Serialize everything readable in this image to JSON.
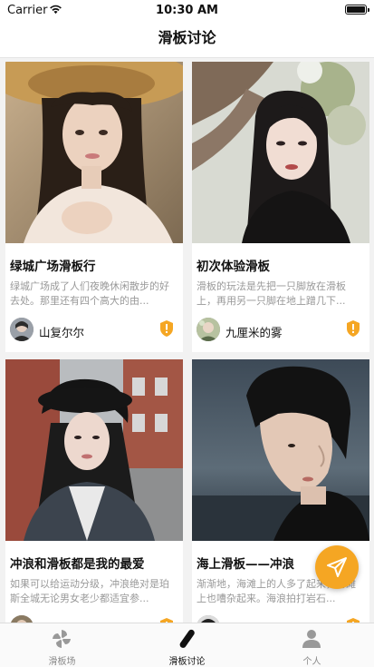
{
  "status_bar": {
    "carrier": "Carrier",
    "time": "10:30 AM"
  },
  "nav": {
    "title": "滑板讨论"
  },
  "posts": [
    {
      "title": "绿城广场滑板行",
      "desc": "绿城广场成了人们夜晚休闲散步的好去处。那里还有四个高大的由...",
      "author": "山复尔尔"
    },
    {
      "title": "初次体验滑板",
      "desc": "滑板的玩法是先把一只脚放在滑板上，再用另一只脚在地上蹭几下...",
      "author": "九厘米的雾"
    },
    {
      "title": "冲浪和滑板都是我的最爱",
      "desc": "如果可以给运动分级，冲浪绝对是珀斯全城无论男女老少都适宜参...",
      "author": ""
    },
    {
      "title": "海上滑板——冲浪",
      "desc": "渐渐地，海滩上的人多了起来，海滩上也嘈杂起来。海浪拍打岩石...",
      "author": ""
    }
  ],
  "tabs": [
    {
      "label": "滑板场",
      "icon": "pinwheel-icon"
    },
    {
      "label": "滑板讨论",
      "icon": "skateboard-icon"
    },
    {
      "label": "个人",
      "icon": "person-icon"
    }
  ],
  "colors": {
    "accent": "#f5a623",
    "shield": "#f5a623"
  }
}
